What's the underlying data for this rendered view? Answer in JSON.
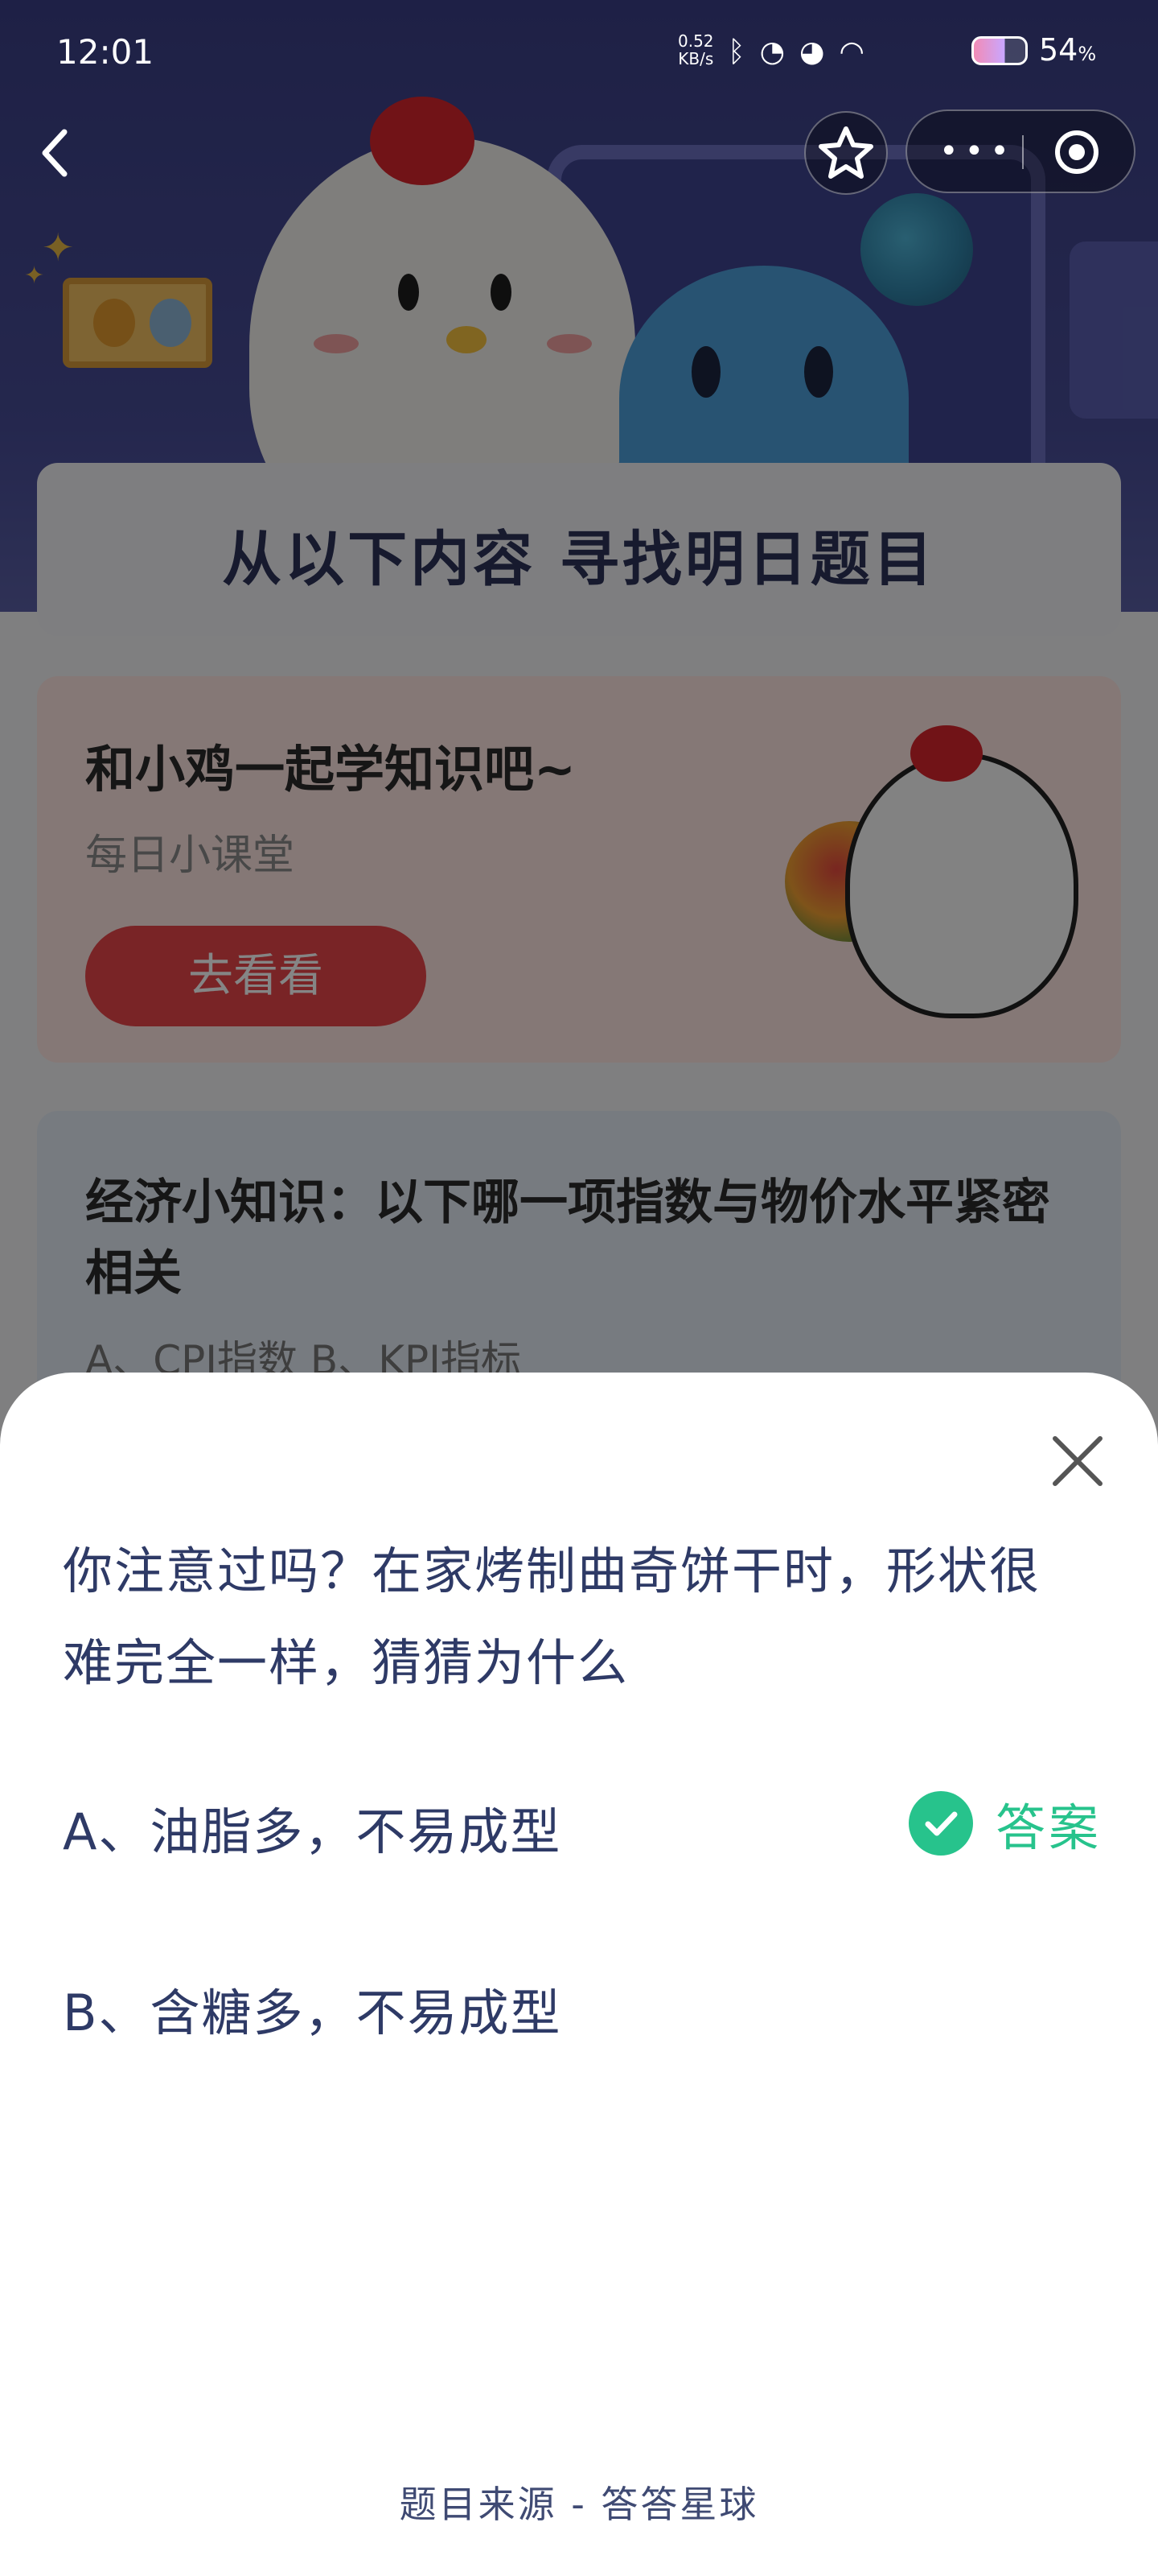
{
  "status_bar": {
    "time": "12:01",
    "net_rate_value": "0.52",
    "net_rate_unit": "KB/s",
    "battery_percent": "54",
    "battery_unit": "%"
  },
  "header": {
    "title_banner": "从以下内容  寻找明日题目"
  },
  "promo_card": {
    "heading": "和小鸡一起学知识吧~",
    "subtitle": "每日小课堂",
    "button_label": "去看看"
  },
  "quiz_preview_card": {
    "question": "经济小知识：以下哪一项指数与物价水平紧密相关",
    "options_preview": "A、CPI指数    B、KPI指标"
  },
  "sheet": {
    "question": "你注意过吗？在家烤制曲奇饼干时，形状很难完全一样，猜猜为什么",
    "options": [
      {
        "label": "A、油脂多，不易成型"
      },
      {
        "label": "B、含糖多，不易成型"
      }
    ],
    "answer_label": "答案",
    "source": "题目来源 - 答答星球"
  },
  "colors": {
    "accent_green": "#27c38c",
    "question_text": "#2e3a66",
    "button_red": "#e8454a"
  },
  "icons": [
    "back-arrow-icon",
    "star-icon",
    "more-dots-icon",
    "target-icon",
    "close-icon",
    "check-circle-icon",
    "bluetooth-icon",
    "signal-icon",
    "wifi-icon",
    "battery-icon"
  ]
}
